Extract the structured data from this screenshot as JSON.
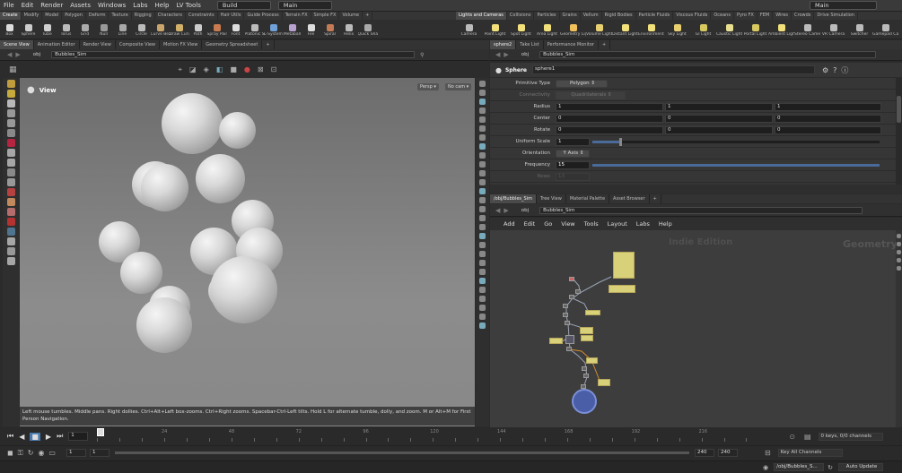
{
  "menu": {
    "items": [
      "File",
      "Edit",
      "Render",
      "Assets",
      "Windows",
      "Labs",
      "Help",
      "LV Tools"
    ],
    "desktop": "Build",
    "context": "Main",
    "right": "Main"
  },
  "shelf": {
    "left_tabs": [
      "Create",
      "Modify",
      "Model",
      "Polygon",
      "Deform",
      "Texture",
      "Rigging",
      "Characters",
      "Constraints",
      "Hair Utils",
      "Guide Process",
      "Terrain FX",
      "Simple FX",
      "Volume"
    ],
    "right_tabs": [
      "Lights and Cameras",
      "Collisions",
      "Particles",
      "Grains",
      "Vellum",
      "Rigid Bodies",
      "Particle Fluids",
      "Viscous Fluids",
      "Oceans",
      "Pyro FX",
      "FEM",
      "Wires",
      "Crowds",
      "Drive Simulation"
    ],
    "left_tools": [
      "Box",
      "Sphere",
      "Tube",
      "Torus",
      "Grid",
      "Null",
      "Line",
      "Circle",
      "Curve Bezier",
      "Draw Curve",
      "Path",
      "Spray Paint",
      "Font",
      "Platonic Solids",
      "L-System",
      "Metaball",
      "File",
      "Spiral",
      "Helix",
      "Quick Shapes"
    ],
    "right_tools": [
      "Camera",
      "Point Light",
      "Spot Light",
      "Area Light",
      "Geometry Light",
      "Volume Light",
      "Distant Light",
      "Environment Light",
      "Sky Light",
      "GI Light",
      "Caustic Light",
      "Portal Light",
      "Ambient Light",
      "Stereo Camera",
      "VR Camera",
      "Switcher",
      "Gamepad Ca..."
    ]
  },
  "left_pane": {
    "tabs": [
      "Scene View",
      "Animation Editor",
      "Render View",
      "Composite View",
      "Motion FX View",
      "Geometry Spreadsheet"
    ],
    "net": "obj",
    "path": "Bubbles_Sim",
    "view_title": "View",
    "persp": "Persp",
    "cam": "No cam",
    "status": "Left mouse tumbles. Middle pans. Right dollies. Ctrl+Alt+Left box-zooms. Ctrl+Right zooms. Spacebar-Ctrl-Left tilts. Hold L for alternate tumble, dolly, and zoom. M or Alt+M for First Person Navigation."
  },
  "params": {
    "tabs": [
      "sphere2",
      "Take List",
      "Performance Monitor"
    ],
    "net": "obj",
    "path": "Bubbles_Sim",
    "type_label": "Sphere",
    "node_name": "sphere1",
    "primitive_type": {
      "label": "Primitive Type",
      "value": "Polygon"
    },
    "connectivity": {
      "label": "Connectivity",
      "value": "Quadrilaterals"
    },
    "radius": {
      "label": "Radius",
      "values": [
        "1",
        "1",
        "1"
      ]
    },
    "center": {
      "label": "Center",
      "values": [
        "0",
        "0",
        "0"
      ]
    },
    "rotate": {
      "label": "Rotate",
      "values": [
        "0",
        "0",
        "0"
      ]
    },
    "uniform_scale": {
      "label": "Uniform Scale",
      "value": "1"
    },
    "orientation": {
      "label": "Orientation",
      "value": "Y Axis"
    },
    "frequency": {
      "label": "Frequency",
      "value": "15"
    },
    "rows": {
      "label": "Rows",
      "value": "13"
    }
  },
  "network": {
    "tabs": [
      "/obj/Bubbles_Sim",
      "Tree View",
      "Material Palette",
      "Asset Browser"
    ],
    "net": "obj",
    "path": "Bubbles_Sim",
    "menu": [
      "Add",
      "Edit",
      "Go",
      "View",
      "Tools",
      "Layout",
      "Labs",
      "Help"
    ],
    "watermark": "Indie Edition",
    "context_label": "Geometry"
  },
  "timeline": {
    "ticks": [
      "1",
      "24",
      "48",
      "72",
      "96",
      "120",
      "144",
      "168",
      "192",
      "216"
    ],
    "current_frame": "1",
    "start": "1",
    "start2": "1",
    "end": "240",
    "end2": "240",
    "keys": "0 keys, 0/0 channels",
    "key_all": "Key All Channels"
  },
  "status": {
    "path": "/obj/Bubbles_S...",
    "auto_update": "Auto Update"
  },
  "colors": {
    "yellow_node": "#d9d07a",
    "bg": "#2b2b2b",
    "blue_node": "#4a5ea8"
  }
}
